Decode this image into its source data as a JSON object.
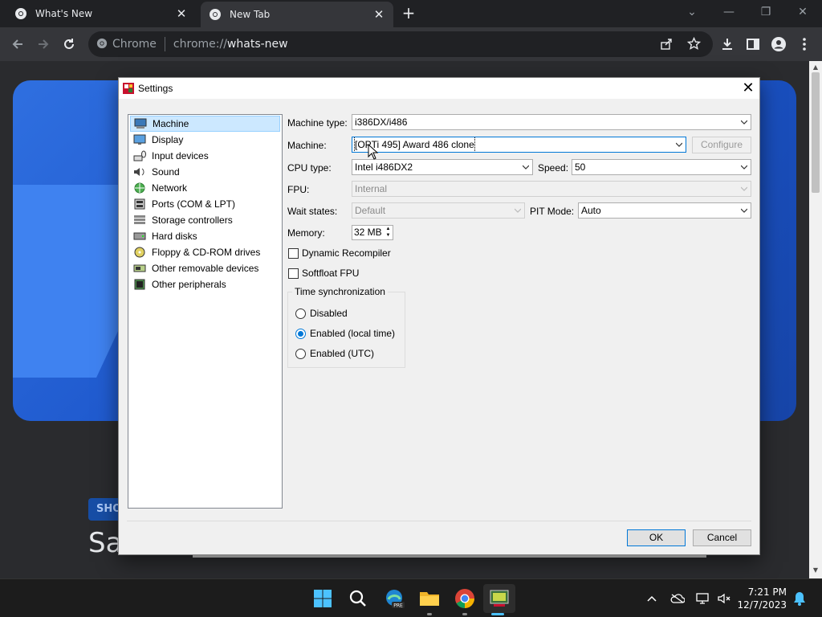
{
  "browser": {
    "tabs": [
      {
        "title": "What's New",
        "active": false
      },
      {
        "title": "New Tab",
        "active": true
      }
    ],
    "omnibox": {
      "chip": "Chrome",
      "url_prefix": "chrome://",
      "url_host": "whats-new"
    }
  },
  "page": {
    "pill_text": "SHO",
    "big_text": "Sa"
  },
  "dialog": {
    "title": "Settings",
    "nav_items": [
      {
        "label": "Machine",
        "icon": "machine-icon",
        "selected": true
      },
      {
        "label": "Display",
        "icon": "display-icon"
      },
      {
        "label": "Input devices",
        "icon": "input-devices-icon"
      },
      {
        "label": "Sound",
        "icon": "sound-icon"
      },
      {
        "label": "Network",
        "icon": "network-icon"
      },
      {
        "label": "Ports (COM & LPT)",
        "icon": "ports-icon"
      },
      {
        "label": "Storage controllers",
        "icon": "storage-controllers-icon"
      },
      {
        "label": "Hard disks",
        "icon": "hard-disk-icon"
      },
      {
        "label": "Floppy & CD-ROM drives",
        "icon": "floppy-cdrom-icon"
      },
      {
        "label": "Other removable devices",
        "icon": "removable-devices-icon"
      },
      {
        "label": "Other peripherals",
        "icon": "peripherals-icon"
      }
    ],
    "fields": {
      "machine_type_label": "Machine type:",
      "machine_type_value": "i386DX/i486",
      "machine_label": "Machine:",
      "machine_value": "[OPTi 495] Award 486 clone",
      "configure_label": "Configure",
      "cpu_type_label": "CPU type:",
      "cpu_type_value": "Intel i486DX2",
      "speed_label": "Speed:",
      "speed_value": "50",
      "fpu_label": "FPU:",
      "fpu_value": "Internal",
      "wait_states_label": "Wait states:",
      "wait_states_value": "Default",
      "pit_mode_label": "PIT Mode:",
      "pit_mode_value": "Auto",
      "memory_label": "Memory:",
      "memory_value": "32 MB",
      "dynamic_recompiler_label": "Dynamic Recompiler",
      "dynamic_recompiler_checked": false,
      "softfloat_label": "Softfloat FPU",
      "softfloat_checked": false
    },
    "time_sync": {
      "title": "Time synchronization",
      "options": [
        {
          "label": "Disabled",
          "selected": false
        },
        {
          "label": "Enabled (local time)",
          "selected": true
        },
        {
          "label": "Enabled (UTC)",
          "selected": false
        }
      ]
    },
    "buttons": {
      "ok": "OK",
      "cancel": "Cancel"
    }
  },
  "taskbar": {
    "time": "7:21 PM",
    "date": "12/7/2023",
    "apps": [
      "windows-start-icon",
      "search-icon",
      "edge-beta-icon",
      "file-explorer-icon",
      "chrome-icon",
      "86box-icon"
    ],
    "edge_badge": "PRE"
  },
  "colors": {
    "accent": "#0078d7",
    "selection": "#cce8ff",
    "chrome_dark": "#202124",
    "hero_blue": "#1b54c9"
  }
}
